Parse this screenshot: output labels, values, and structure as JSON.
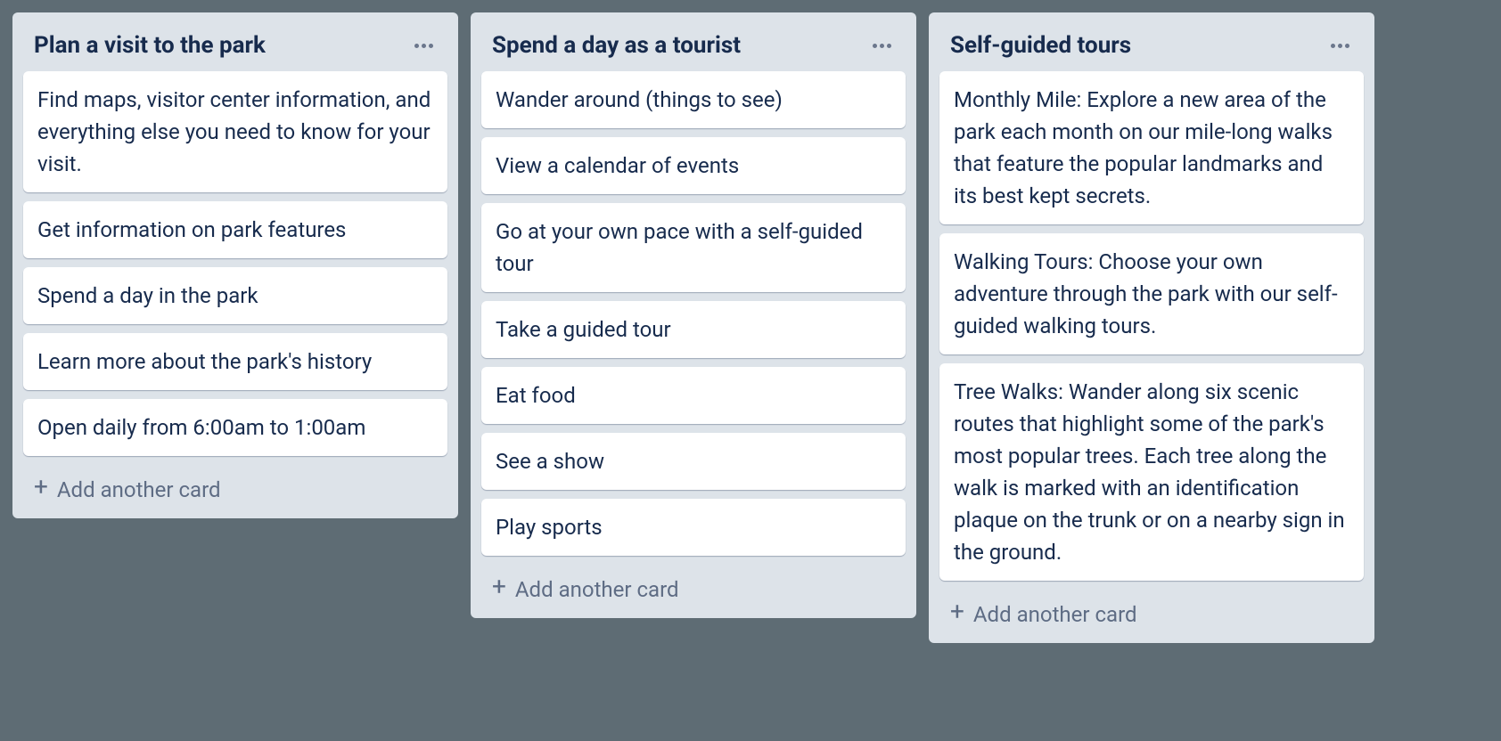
{
  "lists": [
    {
      "title": "Plan a visit to the park",
      "cards": [
        "Find maps, visitor center information, and everything else you need to know for your visit.",
        "Get information on park features",
        "Spend a day in the park",
        "Learn more about the park's history",
        "Open daily from 6:00am to 1:00am"
      ],
      "add_label": "Add another card"
    },
    {
      "title": "Spend a day as a tourist",
      "cards": [
        "Wander around (things to see)",
        "View a calendar of events",
        "Go at your own pace with a self-guided tour",
        "Take a guided tour",
        "Eat food",
        "See a show",
        "Play sports"
      ],
      "add_label": "Add another card"
    },
    {
      "title": "Self-guided tours",
      "cards": [
        "Monthly Mile: Explore a new area of the park each month on our mile-long walks that feature the popular landmarks and its best kept secrets.",
        "Walking Tours: Choose your own adventure through the park with our self-guided walking tours.",
        "Tree Walks: Wander along six scenic routes that highlight some of the park's most popular trees. Each tree along the walk is marked with an identification plaque on the trunk or on a nearby sign in the ground."
      ],
      "add_label": "Add another card"
    }
  ]
}
